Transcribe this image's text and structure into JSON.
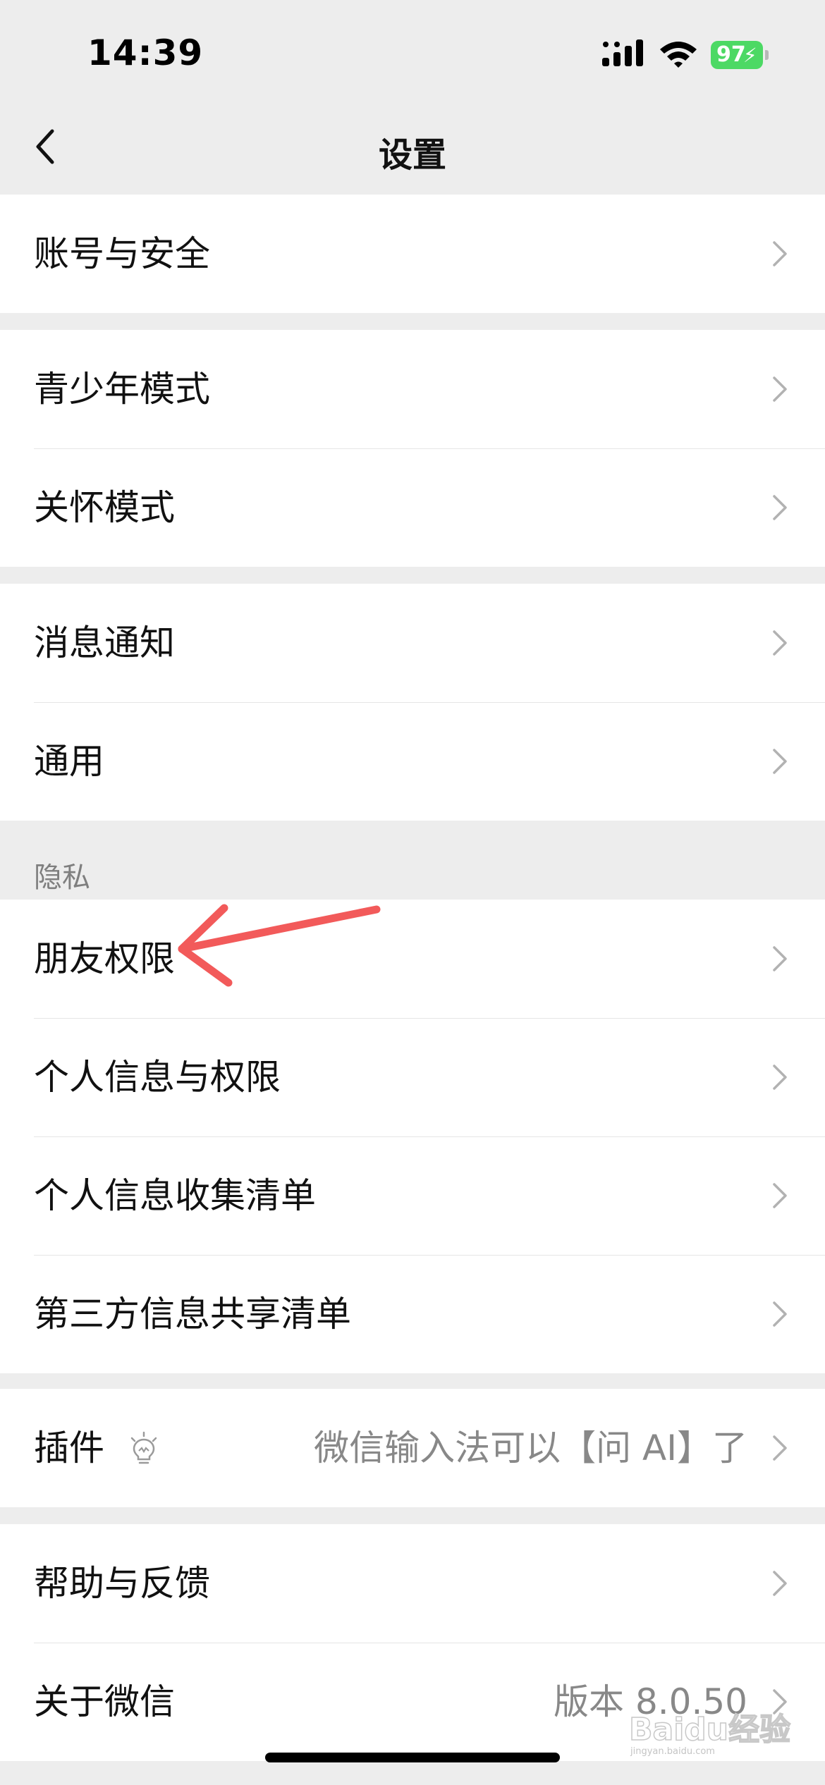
{
  "status_bar": {
    "time": "14:39",
    "battery": "97"
  },
  "nav": {
    "title": "设置"
  },
  "groups": {
    "account": {
      "items": [
        {
          "label": "账号与安全"
        }
      ]
    },
    "modes": {
      "items": [
        {
          "label": "青少年模式"
        },
        {
          "label": "关怀模式"
        }
      ]
    },
    "general": {
      "items": [
        {
          "label": "消息通知"
        },
        {
          "label": "通用"
        }
      ]
    },
    "privacy": {
      "header": "隐私",
      "items": [
        {
          "label": "朋友权限"
        },
        {
          "label": "个人信息与权限"
        },
        {
          "label": "个人信息收集清单"
        },
        {
          "label": "第三方信息共享清单"
        }
      ]
    },
    "plugins": {
      "items": [
        {
          "label": "插件",
          "value": "微信输入法可以【问 AI】了",
          "icon": "lightbulb-icon"
        }
      ]
    },
    "about": {
      "items": [
        {
          "label": "帮助与反馈"
        },
        {
          "label": "关于微信",
          "value": "版本 8.0.50"
        }
      ]
    }
  },
  "annotation": {
    "type": "arrow",
    "color": "#f25a5a",
    "target": "朋友权限"
  },
  "watermark": {
    "text": "Baidu经验",
    "sub": "jingyan.baidu.com"
  },
  "colors": {
    "background": "#ededed",
    "card": "#ffffff",
    "battery": "#4cd964",
    "secondary_text": "#888888",
    "arrow": "#f25a5a"
  }
}
